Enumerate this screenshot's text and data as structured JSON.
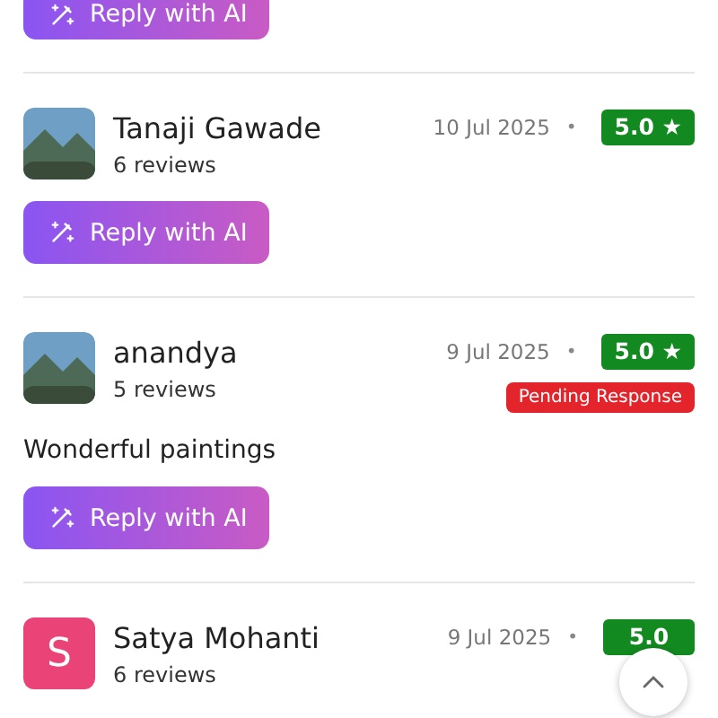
{
  "reviews": [
    {
      "kind": "reply_only",
      "reply_button": {
        "label": "Reply with AI"
      }
    },
    {
      "kind": "full",
      "avatar": {
        "kind": "photo"
      },
      "name": "Tanaji Gawade",
      "review_count": "6 reviews",
      "date": "10 Jul 2025",
      "separator": "•",
      "rating": "5.0 ★",
      "reply_button": {
        "label": "Reply with AI"
      }
    },
    {
      "kind": "full",
      "avatar": {
        "kind": "photo"
      },
      "name": "anandya",
      "review_count": "5 reviews",
      "date": "9 Jul 2025",
      "separator": "•",
      "rating": "5.0 ★",
      "status": "Pending Response",
      "text": "Wonderful paintings",
      "reply_button": {
        "label": "Reply with AI"
      }
    },
    {
      "kind": "full",
      "avatar": {
        "kind": "letter",
        "letter": "S",
        "color": "#e94378"
      },
      "name": "Satya Mohanti",
      "review_count": "6 reviews",
      "date": "9 Jul 2025",
      "separator": "•",
      "rating": "5.0"
    }
  ]
}
